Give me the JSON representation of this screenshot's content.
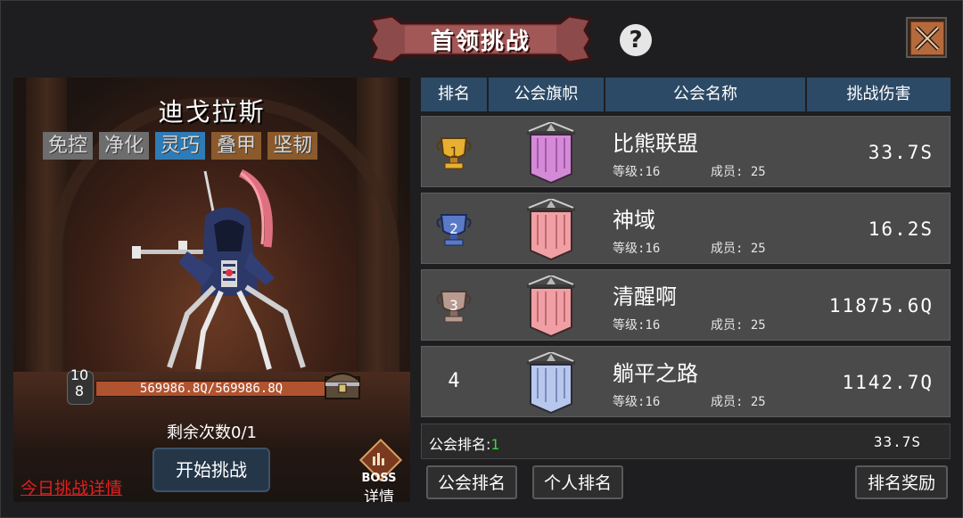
{
  "header": {
    "title": "首领挑战",
    "help_symbol": "?"
  },
  "boss": {
    "name": "迪戈拉斯",
    "tags": [
      {
        "label": "免控",
        "color": "#6d6d6d"
      },
      {
        "label": "净化",
        "color": "#6d6d6d"
      },
      {
        "label": "灵巧",
        "color": "#2f7bb5"
      },
      {
        "label": "叠甲",
        "color": "#8a5a2c"
      },
      {
        "label": "坚韧",
        "color": "#8a5a2c"
      }
    ],
    "level_top": "10",
    "level_bottom": "8",
    "hp_text": "569986.8Q/569986.8Q",
    "hp_fraction": 1.0,
    "remaining_attempts": "剩余次数0/1",
    "start_button": "开始挑战",
    "today_details_link": "今日挑战详情",
    "detail_label_top": "BOSS",
    "detail_label_bottom": "详情"
  },
  "table": {
    "columns": [
      "排名",
      "公会旗帜",
      "公会名称",
      "挑战伤害"
    ],
    "rows": [
      {
        "rank": "1",
        "medal": "gold-trophy-icon",
        "flag_color": "#d58ad8",
        "name": "比熊联盟",
        "level": "等级:16",
        "members": "成员: 25",
        "damage": "33.7S"
      },
      {
        "rank": "2",
        "medal": "blue-trophy-icon",
        "flag_color": "#f0a0a4",
        "name": "神域",
        "level": "等级:16",
        "members": "成员: 25",
        "damage": "16.2S"
      },
      {
        "rank": "3",
        "medal": "bronze-trophy-icon",
        "flag_color": "#f0a0a4",
        "name": "清醒啊",
        "level": "等级:16",
        "members": "成员: 25",
        "damage": "11875.6Q"
      },
      {
        "rank": "4",
        "medal": "",
        "flag_color": "#b8c8ec",
        "name": "躺平之路",
        "level": "等级:16",
        "members": "成员: 25",
        "damage": "1142.7Q"
      }
    ]
  },
  "my_guild": {
    "rank_label": "公会排名:",
    "rank_value": "1",
    "damage": "33.7S"
  },
  "buttons": {
    "guild_rank": "公会排名",
    "personal_rank": "个人排名",
    "rank_rewards": "排名奖励"
  }
}
